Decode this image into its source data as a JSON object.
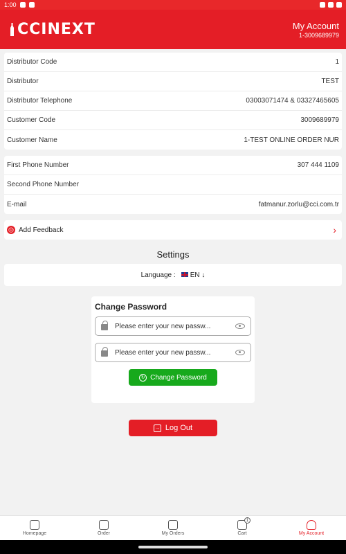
{
  "status": {
    "time": "1:00"
  },
  "header": {
    "logo": "CCINEXT",
    "title": "My Account",
    "subtitle": "1-3009689979"
  },
  "distributor": [
    {
      "label": "Distributor Code",
      "value": "1"
    },
    {
      "label": "Distributor",
      "value": "TEST"
    },
    {
      "label": "Distributor Telephone",
      "value": "03003071474 & 03327465605"
    },
    {
      "label": "Customer Code",
      "value": "3009689979"
    },
    {
      "label": "Customer Name",
      "value": "1-TEST ONLINE ORDER NUR"
    }
  ],
  "contact": [
    {
      "label": "First Phone Number",
      "value": "307 444 1109"
    },
    {
      "label": "Second Phone Number",
      "value": ""
    },
    {
      "label": "E-mail",
      "value": "fatmanur.zorlu@cci.com.tr"
    }
  ],
  "feedback": {
    "label": "Add Feedback"
  },
  "settings": {
    "title": "Settings",
    "language_label": "Language :",
    "language_value": "EN"
  },
  "password": {
    "title": "Change Password",
    "placeholder1": "Please enter your new passw...",
    "placeholder2": "Please enter your new passw...",
    "button": "Change Password"
  },
  "logout": {
    "label": "Log Out"
  },
  "tabs": [
    {
      "label": "Homepage",
      "icon": "home-icon"
    },
    {
      "label": "Order",
      "icon": "order-icon"
    },
    {
      "label": "My Orders",
      "icon": "my-orders-icon"
    },
    {
      "label": "Cart",
      "icon": "cart-icon",
      "badge": "1"
    },
    {
      "label": "My Account",
      "icon": "account-icon",
      "active": true
    }
  ],
  "colors": {
    "brand": "#e41e26",
    "success": "#17a91c"
  }
}
